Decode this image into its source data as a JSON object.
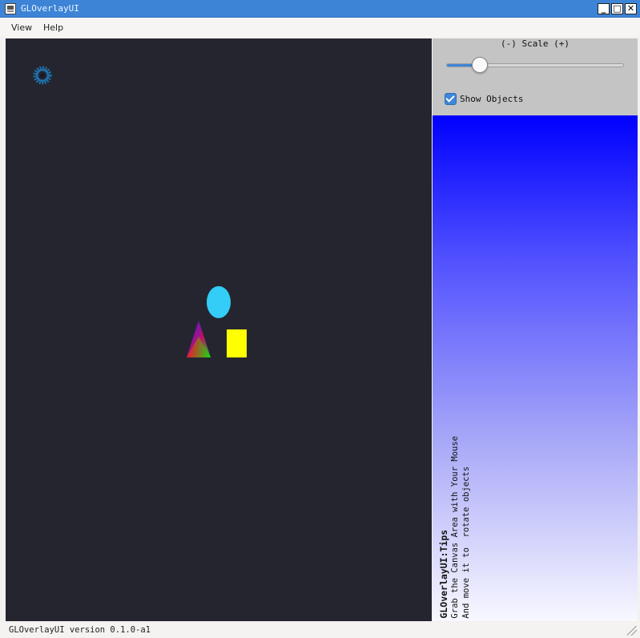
{
  "window": {
    "title": "GLOverlayUI",
    "controls": {
      "minimize": "_",
      "maximize": "□",
      "close": "✕"
    }
  },
  "menu": {
    "items": [
      "View",
      "Help"
    ]
  },
  "controls": {
    "scale_label": "(-) Scale (+)",
    "scale_value": 0.19,
    "show_objects_label": "Show Objects",
    "show_objects_checked": true
  },
  "tips": {
    "title": "GLOverlayUI:Tips",
    "line1": "Grab the Canvas Area with Your Mouse",
    "line2": "And move it to  rotate objects"
  },
  "status": {
    "text": "GLOverlayUI version  0.1.0-a1"
  },
  "colors": {
    "canvas_bg": "#252530",
    "ellipse": "#33cdf7",
    "rectangle": "#ffff00",
    "gear": "#1f6ea8",
    "accent": "#3f86d8"
  }
}
